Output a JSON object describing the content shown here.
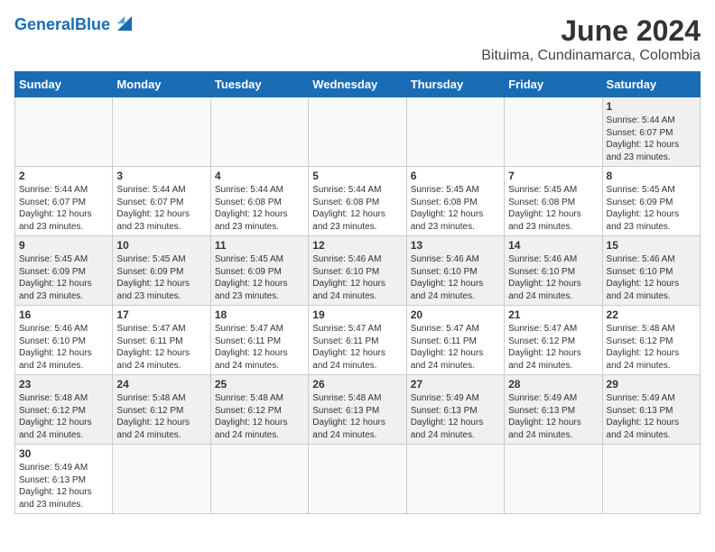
{
  "header": {
    "logo_general": "General",
    "logo_blue": "Blue",
    "month_year": "June 2024",
    "location": "Bituima, Cundinamarca, Colombia"
  },
  "days_of_week": [
    "Sunday",
    "Monday",
    "Tuesday",
    "Wednesday",
    "Thursday",
    "Friday",
    "Saturday"
  ],
  "weeks": [
    [
      {
        "day": "",
        "info": ""
      },
      {
        "day": "",
        "info": ""
      },
      {
        "day": "",
        "info": ""
      },
      {
        "day": "",
        "info": ""
      },
      {
        "day": "",
        "info": ""
      },
      {
        "day": "",
        "info": ""
      },
      {
        "day": "1",
        "info": "Sunrise: 5:44 AM\nSunset: 6:07 PM\nDaylight: 12 hours and 23 minutes."
      }
    ],
    [
      {
        "day": "2",
        "info": "Sunrise: 5:44 AM\nSunset: 6:07 PM\nDaylight: 12 hours and 23 minutes."
      },
      {
        "day": "3",
        "info": "Sunrise: 5:44 AM\nSunset: 6:07 PM\nDaylight: 12 hours and 23 minutes."
      },
      {
        "day": "4",
        "info": "Sunrise: 5:44 AM\nSunset: 6:08 PM\nDaylight: 12 hours and 23 minutes."
      },
      {
        "day": "5",
        "info": "Sunrise: 5:44 AM\nSunset: 6:08 PM\nDaylight: 12 hours and 23 minutes."
      },
      {
        "day": "6",
        "info": "Sunrise: 5:45 AM\nSunset: 6:08 PM\nDaylight: 12 hours and 23 minutes."
      },
      {
        "day": "7",
        "info": "Sunrise: 5:45 AM\nSunset: 6:08 PM\nDaylight: 12 hours and 23 minutes."
      },
      {
        "day": "8",
        "info": "Sunrise: 5:45 AM\nSunset: 6:09 PM\nDaylight: 12 hours and 23 minutes."
      }
    ],
    [
      {
        "day": "9",
        "info": "Sunrise: 5:45 AM\nSunset: 6:09 PM\nDaylight: 12 hours and 23 minutes."
      },
      {
        "day": "10",
        "info": "Sunrise: 5:45 AM\nSunset: 6:09 PM\nDaylight: 12 hours and 23 minutes."
      },
      {
        "day": "11",
        "info": "Sunrise: 5:45 AM\nSunset: 6:09 PM\nDaylight: 12 hours and 23 minutes."
      },
      {
        "day": "12",
        "info": "Sunrise: 5:46 AM\nSunset: 6:10 PM\nDaylight: 12 hours and 24 minutes."
      },
      {
        "day": "13",
        "info": "Sunrise: 5:46 AM\nSunset: 6:10 PM\nDaylight: 12 hours and 24 minutes."
      },
      {
        "day": "14",
        "info": "Sunrise: 5:46 AM\nSunset: 6:10 PM\nDaylight: 12 hours and 24 minutes."
      },
      {
        "day": "15",
        "info": "Sunrise: 5:46 AM\nSunset: 6:10 PM\nDaylight: 12 hours and 24 minutes."
      }
    ],
    [
      {
        "day": "16",
        "info": "Sunrise: 5:46 AM\nSunset: 6:10 PM\nDaylight: 12 hours and 24 minutes."
      },
      {
        "day": "17",
        "info": "Sunrise: 5:47 AM\nSunset: 6:11 PM\nDaylight: 12 hours and 24 minutes."
      },
      {
        "day": "18",
        "info": "Sunrise: 5:47 AM\nSunset: 6:11 PM\nDaylight: 12 hours and 24 minutes."
      },
      {
        "day": "19",
        "info": "Sunrise: 5:47 AM\nSunset: 6:11 PM\nDaylight: 12 hours and 24 minutes."
      },
      {
        "day": "20",
        "info": "Sunrise: 5:47 AM\nSunset: 6:11 PM\nDaylight: 12 hours and 24 minutes."
      },
      {
        "day": "21",
        "info": "Sunrise: 5:47 AM\nSunset: 6:12 PM\nDaylight: 12 hours and 24 minutes."
      },
      {
        "day": "22",
        "info": "Sunrise: 5:48 AM\nSunset: 6:12 PM\nDaylight: 12 hours and 24 minutes."
      }
    ],
    [
      {
        "day": "23",
        "info": "Sunrise: 5:48 AM\nSunset: 6:12 PM\nDaylight: 12 hours and 24 minutes."
      },
      {
        "day": "24",
        "info": "Sunrise: 5:48 AM\nSunset: 6:12 PM\nDaylight: 12 hours and 24 minutes."
      },
      {
        "day": "25",
        "info": "Sunrise: 5:48 AM\nSunset: 6:12 PM\nDaylight: 12 hours and 24 minutes."
      },
      {
        "day": "26",
        "info": "Sunrise: 5:48 AM\nSunset: 6:13 PM\nDaylight: 12 hours and 24 minutes."
      },
      {
        "day": "27",
        "info": "Sunrise: 5:49 AM\nSunset: 6:13 PM\nDaylight: 12 hours and 24 minutes."
      },
      {
        "day": "28",
        "info": "Sunrise: 5:49 AM\nSunset: 6:13 PM\nDaylight: 12 hours and 24 minutes."
      },
      {
        "day": "29",
        "info": "Sunrise: 5:49 AM\nSunset: 6:13 PM\nDaylight: 12 hours and 24 minutes."
      }
    ],
    [
      {
        "day": "30",
        "info": "Sunrise: 5:49 AM\nSunset: 6:13 PM\nDaylight: 12 hours and 23 minutes."
      },
      {
        "day": "",
        "info": ""
      },
      {
        "day": "",
        "info": ""
      },
      {
        "day": "",
        "info": ""
      },
      {
        "day": "",
        "info": ""
      },
      {
        "day": "",
        "info": ""
      },
      {
        "day": "",
        "info": ""
      }
    ]
  ],
  "row_classes": [
    "row-even",
    "row-odd",
    "row-even",
    "row-odd",
    "row-even",
    "row-odd"
  ]
}
